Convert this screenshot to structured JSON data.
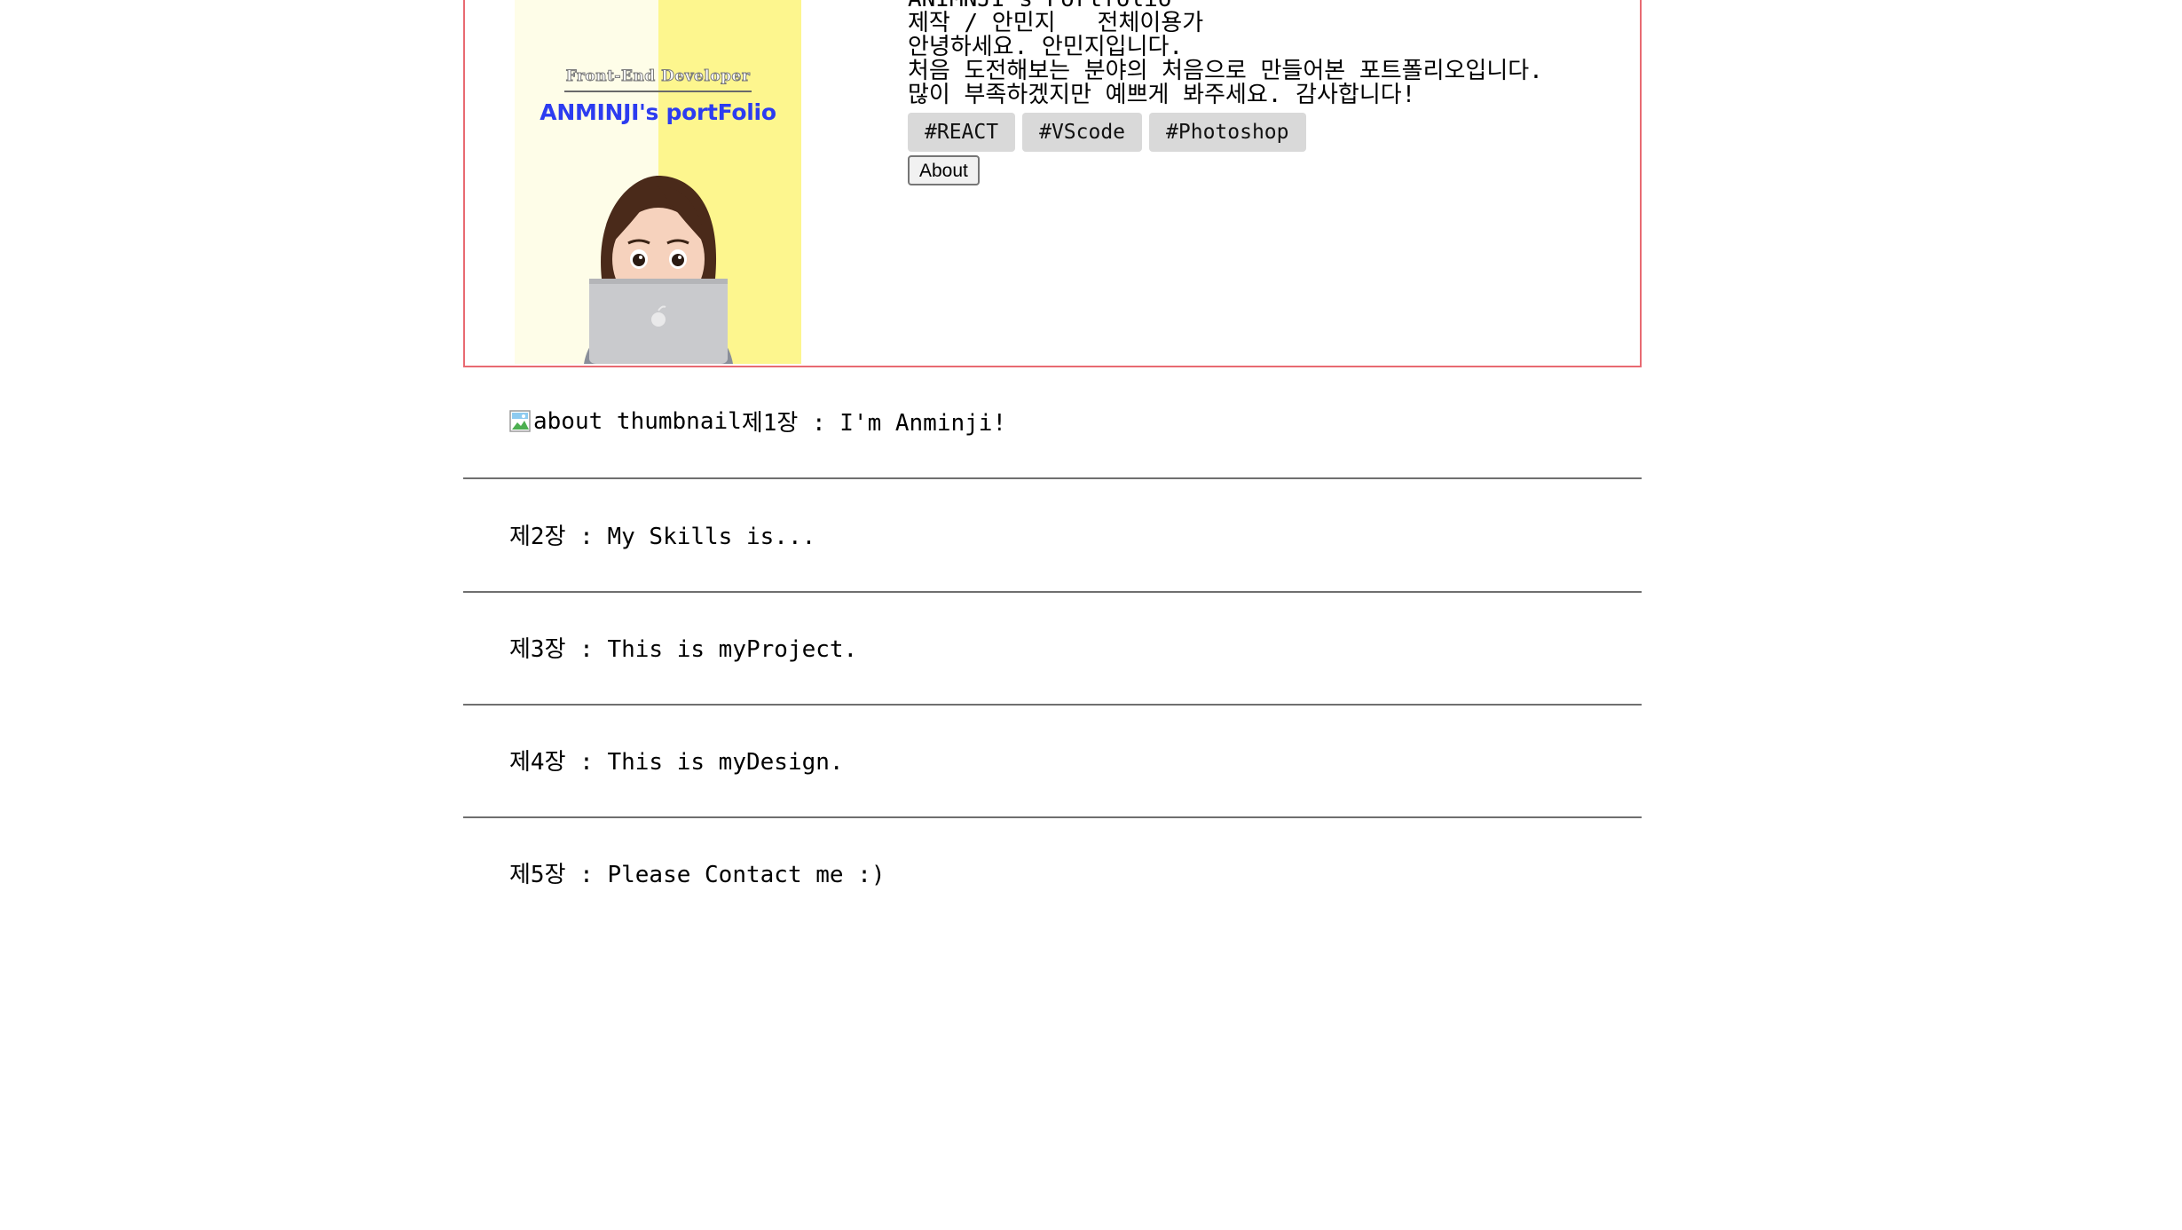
{
  "hero": {
    "thumbnail": {
      "subtitle": "Front-End Developer",
      "title": "ANMINJI's portFolio"
    },
    "lines": [
      "ANIMNJI's Portfolio",
      "제작 / 안민지   전체이용가",
      "안녕하세요. 안민지입니다.",
      "처음 도전해보는 분야의 처음으로 만들어본 포트폴리오입니다.",
      "많이 부족하겠지만 예쁘게 봐주세요. 감사합니다!"
    ],
    "tags": [
      "#REACT",
      "#VScode",
      "#Photoshop"
    ],
    "about_button": "About"
  },
  "chapters": [
    {
      "image_alt": "about thumbnail",
      "title": "제1장 : I'm Anminji!"
    },
    {
      "title": "제2장 : My Skills is..."
    },
    {
      "title": "제3장 : This is myProject."
    },
    {
      "title": "제4장 : This is myDesign."
    },
    {
      "title": "제5장 : Please Contact me :)"
    }
  ],
  "colors": {
    "hero_border": "#e86a72",
    "tag_bg": "#d9d9d9",
    "thumb_left": "#fefde8",
    "thumb_right": "#fdf68e",
    "thumb_title": "#2c3cf0"
  }
}
